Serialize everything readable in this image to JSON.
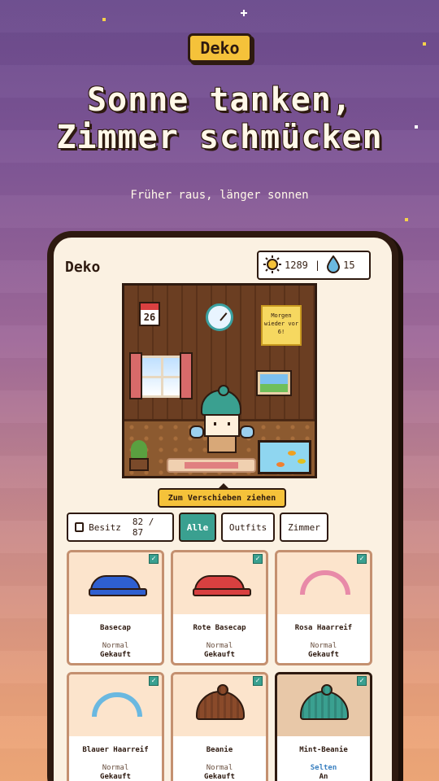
{
  "hero": {
    "pill": "Deko",
    "headline_line1": "Sonne tanken,",
    "headline_line2": "Zimmer schmücken",
    "subline": "Früher raus, länger sonnen"
  },
  "app": {
    "title": "Deko",
    "sun_count": "1289",
    "divider": "|",
    "water_count": "15",
    "calendar_day": "26",
    "note_text": "Morgen wieder vor 6!",
    "drag_hint": "Zum Verschieben ziehen"
  },
  "filters": {
    "own_label": "Besitz",
    "own_count": "82 / 87",
    "tabs": [
      "Alle",
      "Outfits",
      "Zimmer"
    ],
    "active_tab": "Alle"
  },
  "items": [
    {
      "name": "Basecap",
      "rarity": "Normal",
      "status": "Gekauft",
      "color": "#2e5fd0",
      "icon": "cap-icon"
    },
    {
      "name": "Rote Basecap",
      "rarity": "Normal",
      "status": "Gekauft",
      "color": "#d84040",
      "icon": "cap-icon"
    },
    {
      "name": "Rosa Haarreif",
      "rarity": "Normal",
      "status": "Gekauft",
      "color": "#e88aa8",
      "icon": "headband-icon"
    },
    {
      "name": "Blauer Haarreif",
      "rarity": "Normal",
      "status": "Gekauft",
      "color": "#6ab8e0",
      "icon": "headband-icon"
    },
    {
      "name": "Beanie",
      "rarity": "Normal",
      "status": "Gekauft",
      "color": "#8a4a2a",
      "icon": "beanie-icon"
    },
    {
      "name": "Mint-Beanie",
      "rarity": "Selten",
      "status": "An",
      "color": "#3aa090",
      "icon": "beanie-icon"
    }
  ],
  "colors": {
    "accent_yellow": "#f5c23a",
    "accent_teal": "#3aa090",
    "outline": "#2e1a10",
    "screen_bg": "#fbf1e2"
  }
}
